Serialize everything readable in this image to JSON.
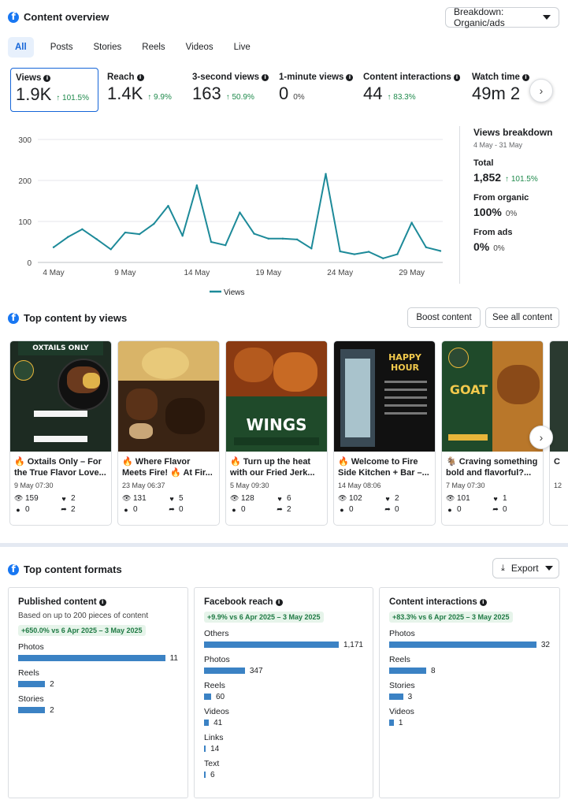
{
  "header": {
    "title": "Content overview",
    "breakdown_button": "Breakdown: Organic/ads"
  },
  "tabs": [
    "All",
    "Posts",
    "Stories",
    "Reels",
    "Videos",
    "Live"
  ],
  "metrics": [
    {
      "label": "Views",
      "value": "1.9K",
      "change": "↑ 101.5%"
    },
    {
      "label": "Reach",
      "value": "1.4K",
      "change": "↑ 9.9%"
    },
    {
      "label": "3-second views",
      "value": "163",
      "change": "↑ 50.9%"
    },
    {
      "label": "1-minute views",
      "value": "0",
      "change": "0%"
    },
    {
      "label": "Content interactions",
      "value": "44",
      "change": "↑ 83.3%"
    },
    {
      "label": "Watch time",
      "value": "49m 2",
      "change": ""
    }
  ],
  "chart_data": {
    "type": "line",
    "title": "",
    "xlabel": "",
    "ylabel": "",
    "x_tick_labels": [
      "4 May",
      "9 May",
      "14 May",
      "19 May",
      "24 May",
      "29 May"
    ],
    "y_ticks": [
      0,
      100,
      200,
      300
    ],
    "ylim": [
      0,
      300
    ],
    "grid": true,
    "legend": "bottom",
    "series": [
      {
        "name": "Views",
        "color": "#1d8a99",
        "x": [
          "4 May",
          "5 May",
          "6 May",
          "7 May",
          "8 May",
          "9 May",
          "10 May",
          "11 May",
          "12 May",
          "13 May",
          "14 May",
          "15 May",
          "16 May",
          "17 May",
          "18 May",
          "19 May",
          "20 May",
          "21 May",
          "22 May",
          "23 May",
          "24 May",
          "25 May",
          "26 May",
          "27 May",
          "28 May",
          "29 May",
          "30 May",
          "31 May"
        ],
        "values": [
          37,
          62,
          81,
          57,
          32,
          73,
          69,
          94,
          138,
          65,
          188,
          50,
          42,
          122,
          70,
          58,
          58,
          56,
          34,
          216,
          27,
          20,
          26,
          10,
          20,
          97,
          37,
          28
        ]
      }
    ]
  },
  "breakdown": {
    "title": "Views breakdown",
    "date_range": "4 May - 31 May",
    "total_label": "Total",
    "total_value": "1,852",
    "total_change": "↑ 101.5%",
    "organic_label": "From organic",
    "organic_value": "100%",
    "organic_change": "0%",
    "ads_label": "From ads",
    "ads_value": "0%",
    "ads_change": "0%"
  },
  "top_content": {
    "title": "Top content by views",
    "boost_button": "Boost content",
    "see_all_button": "See all content",
    "cards": [
      {
        "title": "🔥 Oxtails Only – For the True Flavor Love...",
        "date": "9 May 07:30",
        "views": "159",
        "likes": "2",
        "comments": "0",
        "shares": "2",
        "thumb_text": "OXTAILS ONLY",
        "thumb_bg": "#1d2b22"
      },
      {
        "title": "🔥 Where Flavor Meets Fire! 🔥 At Fir...",
        "date": "23 May 06:37",
        "views": "131",
        "likes": "5",
        "comments": "0",
        "shares": "0",
        "thumb_text": "",
        "thumb_bg": "#4a2e18"
      },
      {
        "title": "🔥 Turn up the heat with our Fried Jerk...",
        "date": "5 May 09:30",
        "views": "128",
        "likes": "6",
        "comments": "0",
        "shares": "2",
        "thumb_text": "WINGS",
        "thumb_bg": "#1f4a2a"
      },
      {
        "title": "🔥 Welcome to Fire Side Kitchen + Bar –...",
        "date": "14 May 08:06",
        "views": "102",
        "likes": "2",
        "comments": "0",
        "shares": "0",
        "thumb_text": "HAPPY HOUR",
        "thumb_bg": "#111111"
      },
      {
        "title": "🐐 Craving something bold and flavorful?...",
        "date": "7 May 07:30",
        "views": "101",
        "likes": "1",
        "comments": "0",
        "shares": "0",
        "thumb_text": "GOAT",
        "thumb_bg": "#1f4a2a"
      },
      {
        "title": "C",
        "date": "12",
        "views": "",
        "likes": "",
        "comments": "",
        "shares": "",
        "thumb_text": "",
        "thumb_bg": "#2a3a30"
      }
    ]
  },
  "formats": {
    "title": "Top content formats",
    "export_button": "Export",
    "published": {
      "title": "Published content",
      "subtitle": "Based on up to 200 pieces of content",
      "change": "+650.0% vs 6 Apr 2025 – 3 May 2025",
      "items": [
        {
          "label": "Photos",
          "value": 11
        },
        {
          "label": "Reels",
          "value": 2
        },
        {
          "label": "Stories",
          "value": 2
        }
      ]
    },
    "reach": {
      "title": "Facebook reach",
      "change": "+9.9% vs 6 Apr 2025 – 3 May 2025",
      "items": [
        {
          "label": "Others",
          "value": 1171,
          "display": "1,171"
        },
        {
          "label": "Photos",
          "value": 347,
          "display": "347"
        },
        {
          "label": "Reels",
          "value": 60,
          "display": "60"
        },
        {
          "label": "Videos",
          "value": 41,
          "display": "41"
        },
        {
          "label": "Links",
          "value": 14,
          "display": "14"
        },
        {
          "label": "Text",
          "value": 6,
          "display": "6"
        }
      ]
    },
    "interactions": {
      "title": "Content interactions",
      "change": "+83.3% vs 6 Apr 2025 – 3 May 2025",
      "items": [
        {
          "label": "Photos",
          "value": 32
        },
        {
          "label": "Reels",
          "value": 8
        },
        {
          "label": "Stories",
          "value": 3
        },
        {
          "label": "Videos",
          "value": 1
        }
      ]
    }
  }
}
